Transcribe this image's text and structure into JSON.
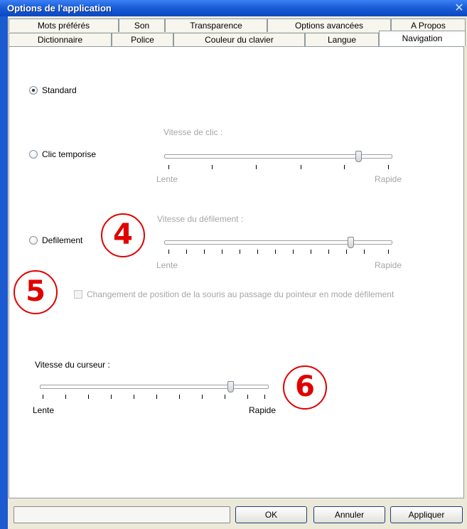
{
  "window": {
    "title": "Options de l'application",
    "close_glyph": "✕"
  },
  "tabs": {
    "row1": [
      "Mots préférés",
      "Son",
      "Transparence",
      "Options avancées",
      "A Propos"
    ],
    "row2": [
      "Dictionnaire",
      "Police",
      "Couleur du clavier",
      "Langue",
      "Navigation"
    ],
    "active": "Navigation"
  },
  "navigation": {
    "standard_label": "Standard",
    "click_label": "Clic temporise",
    "scroll_label": "Defilement",
    "selected_mode": "Standard",
    "click_speed": {
      "caption": "Vitesse de clic :",
      "min_label": "Lente",
      "max_label": "Rapide",
      "level": 0.88
    },
    "scroll_speed": {
      "caption": "Vitesse du défilement :",
      "min_label": "Lente",
      "max_label": "Rapide",
      "level": 0.82
    },
    "mouse_move_checkbox": {
      "label": "Changement de position de la souris au passage du pointeur en mode défilement",
      "checked": false
    },
    "cursor_speed": {
      "caption": "Vitesse du curseur :",
      "min_label": "Lente",
      "max_label": "Rapide",
      "level": 0.85
    }
  },
  "callouts": [
    "4",
    "5",
    "6"
  ],
  "buttons": {
    "ok": "OK",
    "cancel": "Annuler",
    "apply": "Appliquer"
  },
  "colors": {
    "title_bar": "#1b5ed8",
    "callout": "#e00000",
    "disabled_text": "#a6a6a6"
  }
}
